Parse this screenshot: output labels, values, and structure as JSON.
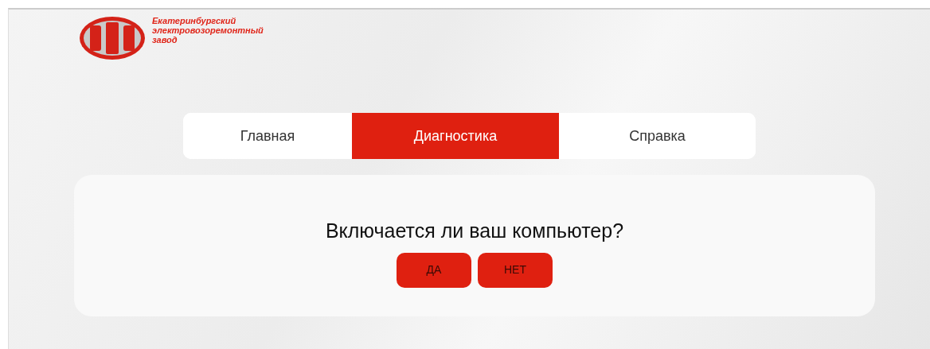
{
  "logo": {
    "company_name": [
      "Екатеринбургский",
      "электровозоремонтный",
      "завод"
    ]
  },
  "tabs": [
    {
      "label": "Главная",
      "selected": false
    },
    {
      "label": "Диагностика",
      "selected": true
    },
    {
      "label": "Справка",
      "selected": false
    }
  ],
  "question": {
    "text": "Включается ли ваш компьютер?",
    "buttons": [
      "ДА",
      "НЕТ"
    ]
  }
}
